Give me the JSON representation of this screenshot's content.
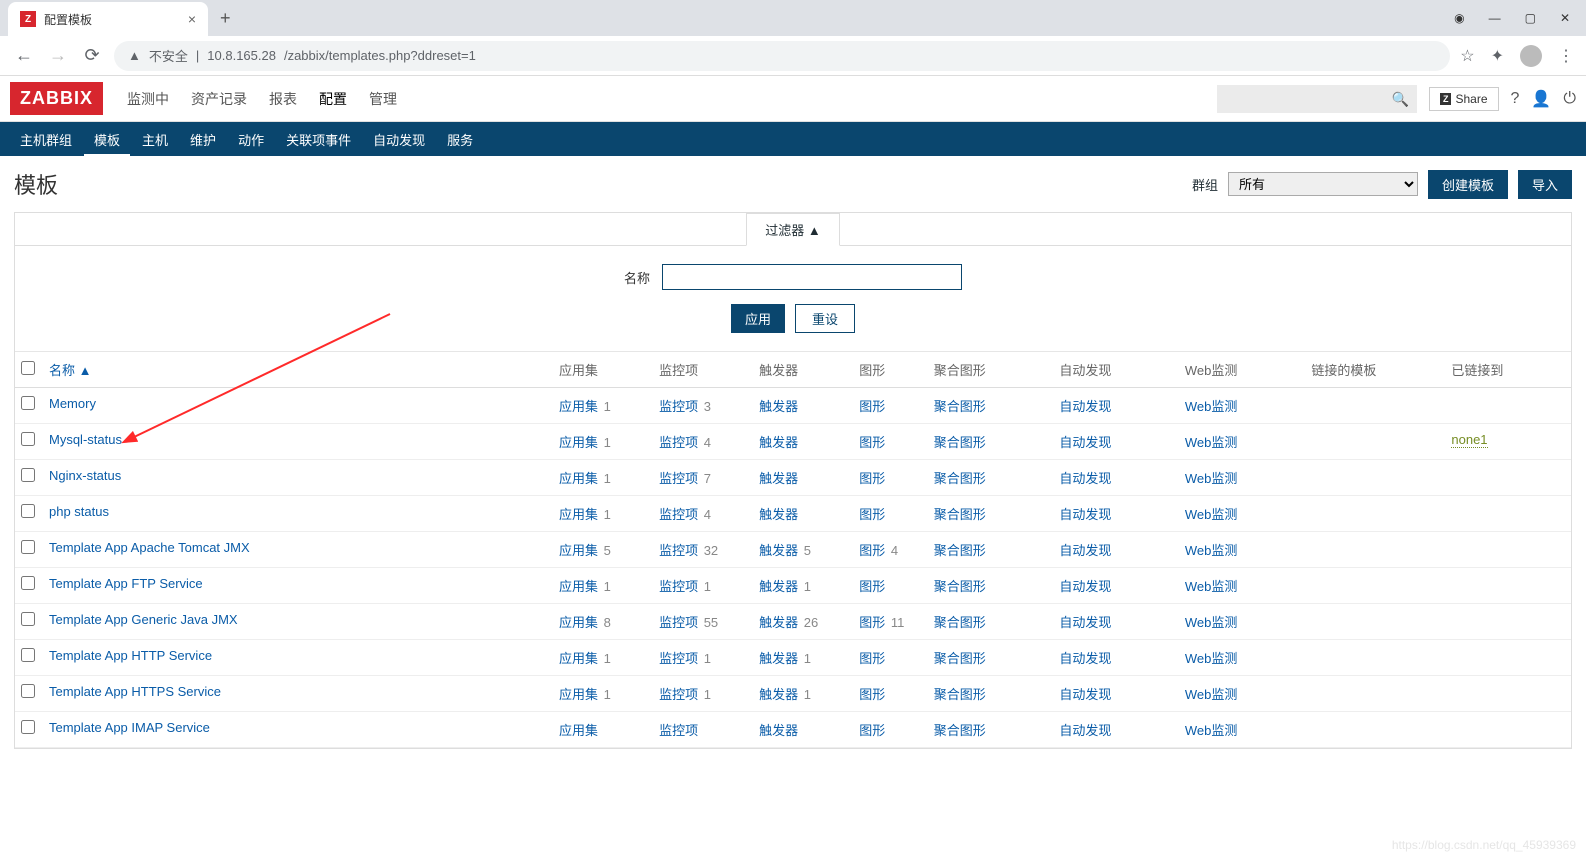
{
  "browser": {
    "tab_title": "配置模板",
    "warn_text": "不安全",
    "url_host": "10.8.165.28",
    "url_path": "/zabbix/templates.php?ddreset=1",
    "window_controls": {
      "min": "—",
      "max": "▢",
      "close": "✕"
    }
  },
  "header": {
    "logo": "ZABBIX",
    "nav": [
      "监测中",
      "资产记录",
      "报表",
      "配置",
      "管理"
    ],
    "nav_active": 3,
    "share": "Share"
  },
  "subnav": {
    "items": [
      "主机群组",
      "模板",
      "主机",
      "维护",
      "动作",
      "关联项事件",
      "自动发现",
      "服务"
    ],
    "active": 1
  },
  "page": {
    "title": "模板",
    "group_label": "群组",
    "group_selected": "所有",
    "create_btn": "创建模板",
    "import_btn": "导入"
  },
  "filter": {
    "tab": "过滤器 ▲",
    "name_label": "名称",
    "apply": "应用",
    "reset": "重设"
  },
  "table": {
    "headers": {
      "name": "名称 ▲",
      "apps": "应用集",
      "items": "监控项",
      "triggers": "触发器",
      "graphs": "图形",
      "screens": "聚合图形",
      "discovery": "自动发现",
      "web": "Web监测",
      "linked_tpl": "链接的模板",
      "linked_to": "已链接到"
    },
    "rows": [
      {
        "name": "Memory",
        "apps": "应用集 1",
        "items": "监控项 3",
        "triggers": "触发器",
        "graphs": "图形",
        "screens": "聚合图形",
        "discovery": "自动发现",
        "web": "Web监测",
        "linked_to": ""
      },
      {
        "name": "Mysql-status",
        "apps": "应用集 1",
        "items": "监控项 4",
        "triggers": "触发器",
        "graphs": "图形",
        "screens": "聚合图形",
        "discovery": "自动发现",
        "web": "Web监测",
        "linked_to": "none1"
      },
      {
        "name": "Nginx-status",
        "apps": "应用集 1",
        "items": "监控项 7",
        "triggers": "触发器",
        "graphs": "图形",
        "screens": "聚合图形",
        "discovery": "自动发现",
        "web": "Web监测",
        "linked_to": ""
      },
      {
        "name": "php status",
        "apps": "应用集 1",
        "items": "监控项 4",
        "triggers": "触发器",
        "graphs": "图形",
        "screens": "聚合图形",
        "discovery": "自动发现",
        "web": "Web监测",
        "linked_to": ""
      },
      {
        "name": "Template App Apache Tomcat JMX",
        "apps": "应用集 5",
        "items": "监控项 32",
        "triggers": "触发器 5",
        "graphs": "图形 4",
        "screens": "聚合图形",
        "discovery": "自动发现",
        "web": "Web监测",
        "linked_to": ""
      },
      {
        "name": "Template App FTP Service",
        "apps": "应用集 1",
        "items": "监控项 1",
        "triggers": "触发器 1",
        "graphs": "图形",
        "screens": "聚合图形",
        "discovery": "自动发现",
        "web": "Web监测",
        "linked_to": ""
      },
      {
        "name": "Template App Generic Java JMX",
        "apps": "应用集 8",
        "items": "监控项 55",
        "triggers": "触发器 26",
        "graphs": "图形 11",
        "screens": "聚合图形",
        "discovery": "自动发现",
        "web": "Web监测",
        "linked_to": ""
      },
      {
        "name": "Template App HTTP Service",
        "apps": "应用集 1",
        "items": "监控项 1",
        "triggers": "触发器 1",
        "graphs": "图形",
        "screens": "聚合图形",
        "discovery": "自动发现",
        "web": "Web监测",
        "linked_to": ""
      },
      {
        "name": "Template App HTTPS Service",
        "apps": "应用集 1",
        "items": "监控项 1",
        "triggers": "触发器 1",
        "graphs": "图形",
        "screens": "聚合图形",
        "discovery": "自动发现",
        "web": "Web监测",
        "linked_to": ""
      },
      {
        "name": "Template App IMAP Service",
        "apps": "应用集",
        "items": "监控项",
        "triggers": "触发器",
        "graphs": "图形",
        "screens": "聚合图形",
        "discovery": "自动发现",
        "web": "Web监测",
        "linked_to": ""
      }
    ]
  },
  "watermark": "https://blog.csdn.net/qq_45939369"
}
